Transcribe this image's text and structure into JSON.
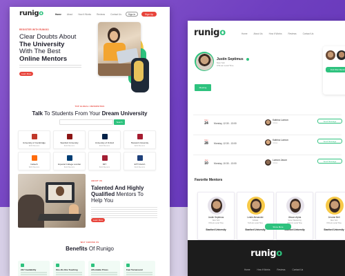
{
  "left": {
    "nav": [
      "Home",
      "About",
      "How It Works",
      "Reviews",
      "Contact Us"
    ],
    "sign_in": "Sign In",
    "sign_up": "Sign Up",
    "hero_kicker": "REGISTER WITH RUNIGO",
    "hero_line1": "Clear Doubts About",
    "hero_line2": "The University",
    "hero_line3": "With The Best",
    "hero_line4": "Online Mentors",
    "hero_cta": "Learn More",
    "global_kicker": "TOP GLOBAL UNIVERSITIES",
    "talk_a": "Talk",
    "talk_b": " To Students From Your ",
    "talk_c": "Dream University",
    "search_btn": "Search",
    "universities": [
      {
        "name": "University of Cambridge",
        "mentors": "$150 Mentors",
        "color": "#c0392b"
      },
      {
        "name": "Stanford University",
        "mentors": "$140 Mentors",
        "color": "#8c1515"
      },
      {
        "name": "University of Oxford",
        "mentors": "$120 Mentors",
        "color": "#002147"
      },
      {
        "name": "Harvard University",
        "mentors": "$220 Mentors",
        "color": "#a51c30"
      },
      {
        "name": "Caltech",
        "mentors": "$200 Mentors",
        "color": "#ff6c0c"
      },
      {
        "name": "Imperial College London",
        "mentors": "$120 Mentors",
        "color": "#003e74"
      },
      {
        "name": "MIT",
        "mentors": "$120 Mentors",
        "color": "#a31f34"
      },
      {
        "name": "ETH Zurich",
        "mentors": "$120 Mentors",
        "color": "#1f407a"
      }
    ],
    "about_kicker": "ABOUT US",
    "about_line1": "Talented And Highly",
    "about_line2a": "Qualified",
    "about_line2b": " Mentors To",
    "about_line3": "Help You",
    "about_cta": "Learn More",
    "why_kicker": "WHY CHOOSE US",
    "benefits_a": "Benefits",
    "benefits_b": " Of Runigo",
    "benefits": [
      "24/7 Availability",
      "One-On-One Teaching",
      "Affordable Prices",
      "Fast Turnaround"
    ]
  },
  "right": {
    "nav": [
      "Home",
      "About Us",
      "How It Works",
      "Reviews",
      "Contact Us"
    ],
    "profile_name": "Justin Septimus",
    "profile_sub1": "New York",
    "profile_sub2": "3:54 am Local Time",
    "find_btn": "Find Other Mentors",
    "tab": "Meeting",
    "sessions": [
      {
        "month": "Nov",
        "day": "24",
        "time": "Monday, 12:30 - 13:00",
        "mentor": "Katrina Lamon",
        "sub": "Cohan"
      },
      {
        "month": "Nov",
        "day": "28",
        "time": "Monday, 12:30 - 13:00",
        "mentor": "Katrina Lamon",
        "sub": "Cohan"
      },
      {
        "month": "Jan",
        "day": "10",
        "time": "Monday, 10:30 - 13:00",
        "mentor": "Lamon Jason",
        "sub": "Cohan"
      }
    ],
    "send_msg": "Send Message",
    "fav_title": "Favorite Mentors",
    "mentors": [
      {
        "name": "Justin Septimus",
        "city": "New York",
        "time": "3:54 am Local Time",
        "uni": "Stanford University",
        "bg": "#e6e2ea"
      },
      {
        "name": "Leslie Alexander",
        "city": "Kolkata",
        "time": "5:24 am Local Time",
        "uni": "Stanford University",
        "bg": "#f7c948"
      },
      {
        "name": "Jikwon Alpha",
        "city": "Some Wandering",
        "time": "3:54 pm Local Time",
        "uni": "Stanford University",
        "bg": "#e6e2ea"
      },
      {
        "name": "Jerome Bell",
        "city": "New York",
        "time": "3:54 am Local Time",
        "uni": "Stanford University",
        "bg": "#f7c948"
      }
    ],
    "show_more": "Show More",
    "footer_logo_a": "runig",
    "footer_logo_b": "o",
    "footer_nav": [
      "Home",
      "How It Works",
      "Reviews",
      "Contact Us"
    ]
  },
  "logo_a": "runig",
  "logo_b": "o",
  "colors": {
    "accent": "#e8453c",
    "brand_green": "#2ec27e",
    "purple_bg": "#6f3fc0"
  }
}
